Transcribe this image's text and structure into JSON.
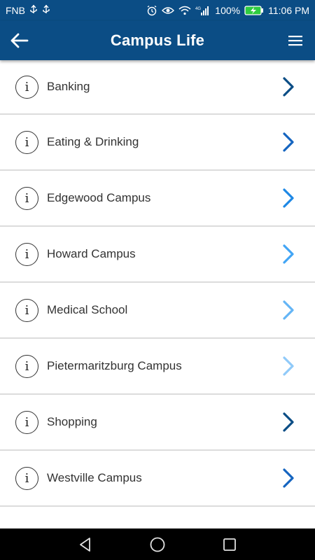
{
  "status_bar": {
    "carrier": "FNB",
    "battery_percent": "100%",
    "network": "4G",
    "time": "11:06 PM"
  },
  "app_bar": {
    "title": "Campus Life",
    "background_color": "#0b4d85"
  },
  "list": {
    "items": [
      {
        "label": "Banking",
        "chevron_color": "#0b4d85"
      },
      {
        "label": "Eating & Drinking",
        "chevron_color": "#1565c0"
      },
      {
        "label": "Edgewood Campus",
        "chevron_color": "#1e88e5"
      },
      {
        "label": "Howard Campus",
        "chevron_color": "#42a5f5"
      },
      {
        "label": "Medical School",
        "chevron_color": "#64b5f6"
      },
      {
        "label": "Pietermaritzburg Campus",
        "chevron_color": "#90caf9"
      },
      {
        "label": "Shopping",
        "chevron_color": "#0b4d85"
      },
      {
        "label": "Westville Campus",
        "chevron_color": "#1565c0"
      }
    ]
  },
  "icons": {
    "back": "back-arrow-icon",
    "menu": "hamburger-menu-icon",
    "info": "info-icon",
    "chevron": "chevron-right-icon",
    "nav_back": "triangle-back-icon",
    "nav_home": "circle-home-icon",
    "nav_recents": "square-recents-icon"
  }
}
